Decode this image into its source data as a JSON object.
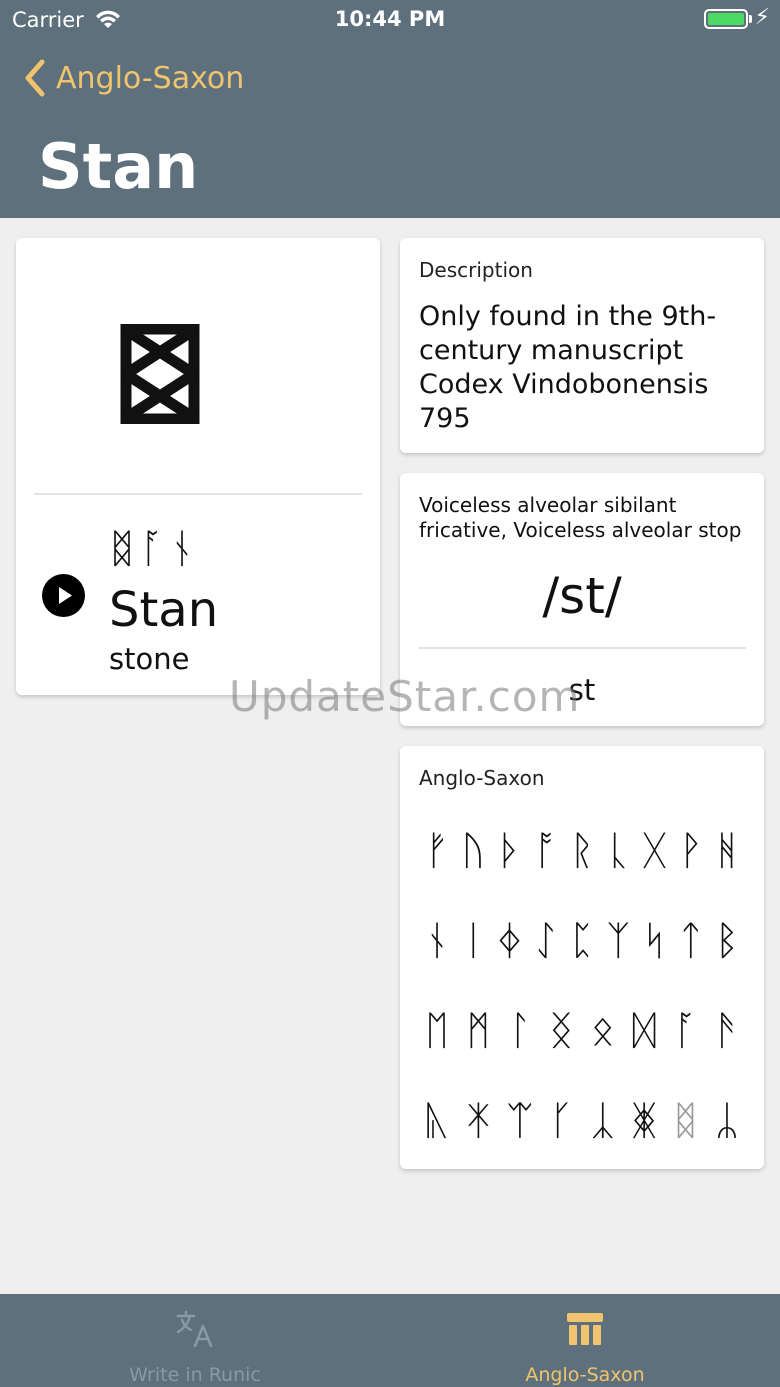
{
  "status": {
    "carrier": "Carrier",
    "time": "10:44 PM"
  },
  "nav": {
    "back_label": "Anglo-Saxon",
    "title": "Stan"
  },
  "rune_card": {
    "rune_icon": "stan-rune",
    "word_runes": "ᛥᚪᚾ",
    "word": "Stan",
    "meaning": "stone"
  },
  "description": {
    "label": "Description",
    "text": "Only found in the 9th-century manuscript Codex Vindobonensis 795"
  },
  "sound": {
    "label": "Voiceless alveolar sibilant fricative, Voiceless alveolar stop",
    "ipa": "/st/",
    "latin": "st"
  },
  "alphabet": {
    "label": "Anglo-Saxon",
    "rows": [
      [
        "ᚠ",
        "ᚢ",
        "ᚦ",
        "ᚩ",
        "ᚱ",
        "ᚳ",
        "ᚷ",
        "ᚹ",
        "ᚻ"
      ],
      [
        "ᚾ",
        "ᛁ",
        "ᛄ",
        "ᛇ",
        "ᛈ",
        "ᛉ",
        "ᛋ",
        "ᛏ",
        "ᛒ"
      ],
      [
        "ᛖ",
        "ᛗ",
        "ᛚ",
        "ᛝ",
        "ᛟ",
        "ᛞ",
        "ᚪ",
        "ᚫ"
      ],
      [
        "ᚣ",
        "ᛡ",
        "ᛠ",
        "ᚴ",
        "ᛣ",
        "ᛤ",
        "ᛥ",
        "ᛦ"
      ]
    ]
  },
  "watermark": "UpdateStar.com",
  "tabs": [
    {
      "label": "Write in Runic",
      "icon": "translate-icon"
    },
    {
      "label": "Anglo-Saxon",
      "icon": "columns-icon"
    }
  ],
  "colors": {
    "header": "#5d707c",
    "accent": "#f0c46e",
    "background": "#efefef"
  }
}
